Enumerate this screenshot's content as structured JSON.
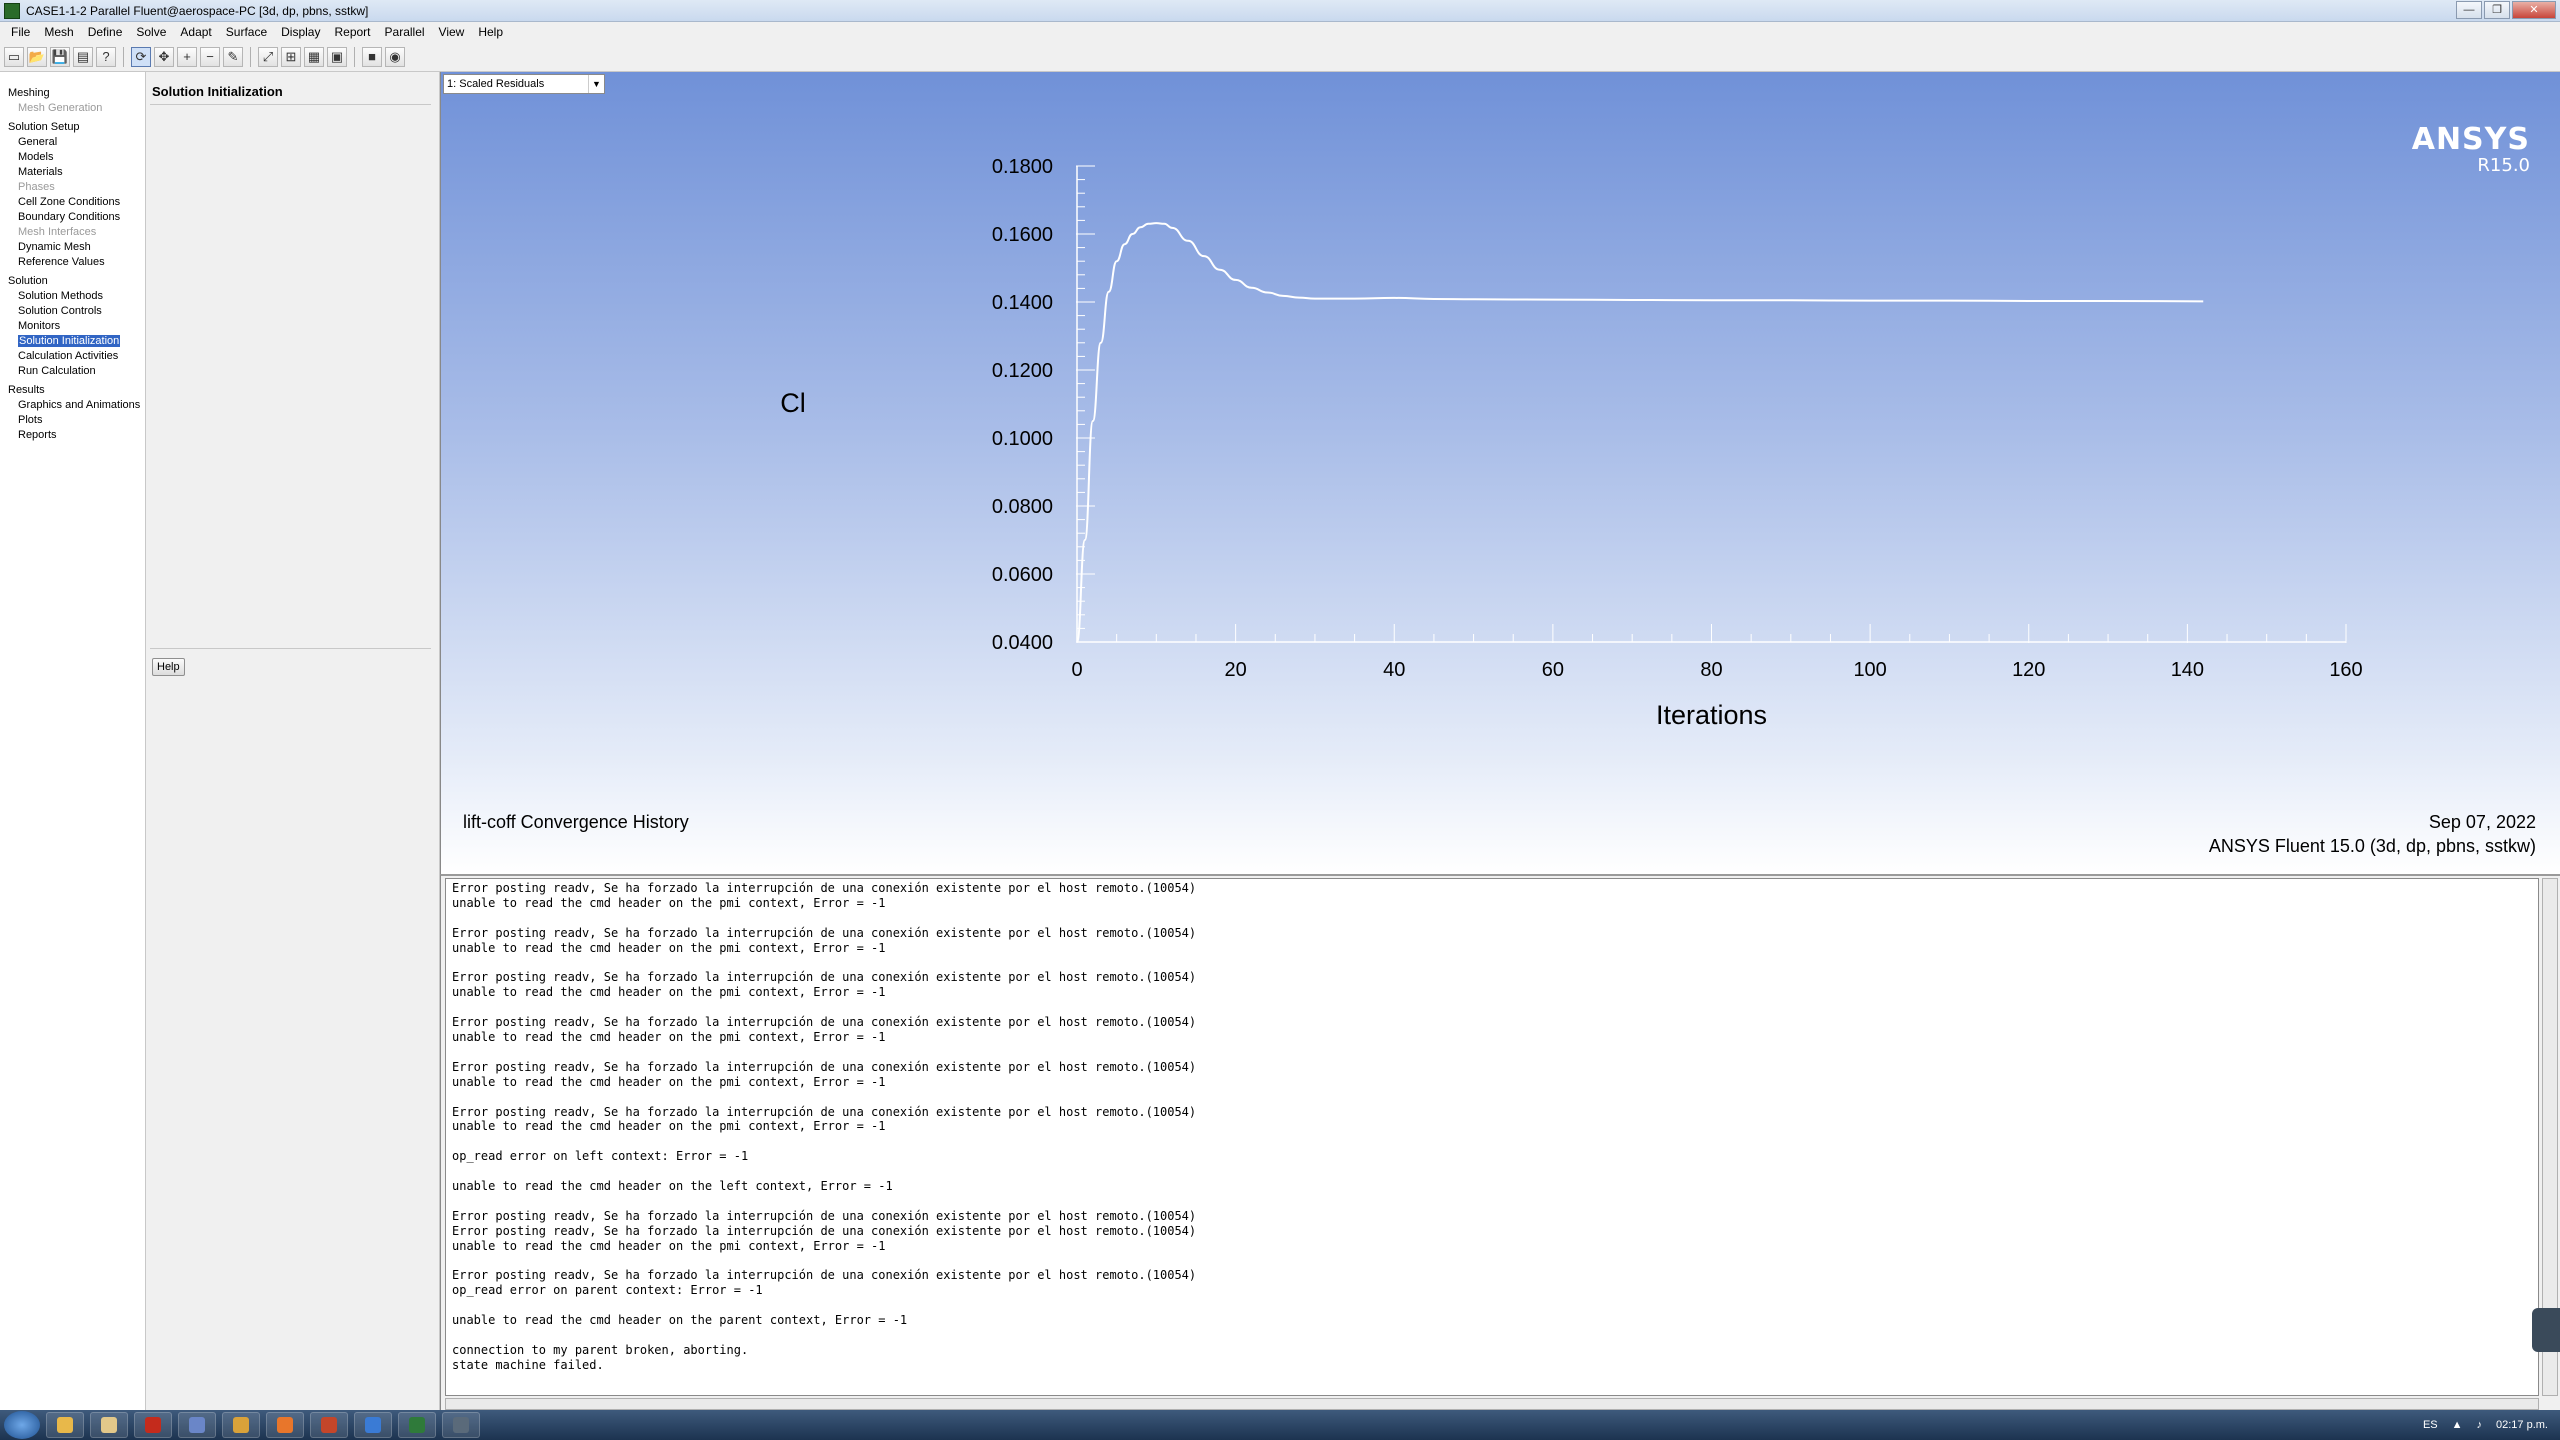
{
  "window": {
    "title": "CASE1-1-2 Parallel Fluent@aerospace-PC  [3d, dp, pbns, sstkw]"
  },
  "menu": [
    "File",
    "Mesh",
    "Define",
    "Solve",
    "Adapt",
    "Surface",
    "Display",
    "Report",
    "Parallel",
    "View",
    "Help"
  ],
  "toolbar_icons": [
    "new-icon",
    "open-icon",
    "save-icon",
    "print-icon",
    "help-icon",
    "rotate-icon",
    "pan-icon",
    "zoom-in-icon",
    "zoom-out-icon",
    "probe-icon",
    "fit-icon",
    "zoom-box-icon",
    "layout-icon",
    "view-icon",
    "display-icon",
    "camera-icon"
  ],
  "tree": {
    "meshing": {
      "label": "Meshing",
      "items": [
        {
          "label": "Mesh Generation",
          "disabled": true
        }
      ]
    },
    "solution_setup": {
      "label": "Solution Setup",
      "items": [
        {
          "label": "General"
        },
        {
          "label": "Models"
        },
        {
          "label": "Materials"
        },
        {
          "label": "Phases",
          "disabled": true
        },
        {
          "label": "Cell Zone Conditions"
        },
        {
          "label": "Boundary Conditions"
        },
        {
          "label": "Mesh Interfaces",
          "disabled": true
        },
        {
          "label": "Dynamic Mesh"
        },
        {
          "label": "Reference Values"
        }
      ]
    },
    "solution": {
      "label": "Solution",
      "items": [
        {
          "label": "Solution Methods"
        },
        {
          "label": "Solution Controls"
        },
        {
          "label": "Monitors"
        },
        {
          "label": "Solution Initialization",
          "selected": true
        },
        {
          "label": "Calculation Activities"
        },
        {
          "label": "Run Calculation"
        }
      ]
    },
    "results": {
      "label": "Results",
      "items": [
        {
          "label": "Graphics and Animations"
        },
        {
          "label": "Plots"
        },
        {
          "label": "Reports"
        }
      ]
    }
  },
  "task_page": {
    "title": "Solution Initialization",
    "help_label": "Help"
  },
  "graphics": {
    "window_selector": "1: Scaled Residuals",
    "logo_brand": "ANSYS",
    "logo_version": "R15.0",
    "plot_title": "lift-coff Convergence History",
    "date": "Sep 07, 2022",
    "solver_info": "ANSYS Fluent 15.0 (3d, dp, pbns, sstkw)",
    "line_color": "#ffffff"
  },
  "chart_data": {
    "type": "line",
    "title": "lift-coff Convergence History",
    "xlabel": "Iterations",
    "ylabel": "Cl",
    "xlim": [
      0,
      160
    ],
    "ylim": [
      0.04,
      0.18
    ],
    "x_ticks": [
      "0",
      "20",
      "40",
      "60",
      "80",
      "100",
      "120",
      "140",
      "160"
    ],
    "y_ticks": [
      "0.0400",
      "0.0600",
      "0.0800",
      "0.1000",
      "0.1200",
      "0.1400",
      "0.1600",
      "0.1800"
    ],
    "grid": false,
    "series": [
      {
        "x": [
          0,
          1,
          2,
          3,
          4,
          5,
          6,
          7,
          8,
          9,
          10,
          11,
          12,
          14,
          16,
          18,
          20,
          22,
          24,
          26,
          28,
          30,
          35,
          40,
          45,
          50,
          60,
          70,
          80,
          90,
          100,
          110,
          120,
          130,
          142
        ],
        "values": [
          0.04,
          0.07,
          0.105,
          0.128,
          0.143,
          0.152,
          0.157,
          0.16,
          0.162,
          0.163,
          0.1632,
          0.163,
          0.1618,
          0.158,
          0.1535,
          0.1495,
          0.1465,
          0.1442,
          0.1428,
          0.1418,
          0.1413,
          0.141,
          0.141,
          0.1412,
          0.1409,
          0.1408,
          0.1407,
          0.1406,
          0.1405,
          0.1405,
          0.1404,
          0.1404,
          0.1403,
          0.1403,
          0.1402
        ]
      }
    ]
  },
  "console": {
    "lines": [
      "Error posting readv, Se ha forzado la interrupción de una conexión existente por el host remoto.(10054)",
      "unable to read the cmd header on the pmi context, Error = -1",
      "",
      "Error posting readv, Se ha forzado la interrupción de una conexión existente por el host remoto.(10054)",
      "unable to read the cmd header on the pmi context, Error = -1",
      "",
      "Error posting readv, Se ha forzado la interrupción de una conexión existente por el host remoto.(10054)",
      "unable to read the cmd header on the pmi context, Error = -1",
      "",
      "Error posting readv, Se ha forzado la interrupción de una conexión existente por el host remoto.(10054)",
      "unable to read the cmd header on the pmi context, Error = -1",
      "",
      "Error posting readv, Se ha forzado la interrupción de una conexión existente por el host remoto.(10054)",
      "unable to read the cmd header on the pmi context, Error = -1",
      "",
      "Error posting readv, Se ha forzado la interrupción de una conexión existente por el host remoto.(10054)",
      "unable to read the cmd header on the pmi context, Error = -1",
      "",
      "op_read error on left context: Error = -1",
      "",
      "unable to read the cmd header on the left context, Error = -1",
      "",
      "Error posting readv, Se ha forzado la interrupción de una conexión existente por el host remoto.(10054)",
      "Error posting readv, Se ha forzado la interrupción de una conexión existente por el host remoto.(10054)",
      "unable to read the cmd header on the pmi context, Error = -1",
      "",
      "Error posting readv, Se ha forzado la interrupción de una conexión existente por el host remoto.(10054)",
      "op_read error on parent context: Error = -1",
      "",
      "unable to read the cmd header on the parent context, Error = -1",
      "",
      "connection to my parent broken, aborting.",
      "state machine failed."
    ]
  },
  "taskbar": {
    "apps": [
      "explorer-icon",
      "folder-icon",
      "acrobat-icon",
      "chrome-icon",
      "chrome-icon",
      "firefox-icon",
      "firefox-icon",
      "teamviewer-icon",
      "fluent-icon",
      "fluent-launcher-icon"
    ],
    "app_colors": [
      "#e8b84a",
      "#e2c88a",
      "#c42b1c",
      "#6a86c8",
      "#d9a23a",
      "#e8762b",
      "#c4462a",
      "#3a7bd5",
      "#2f7a3a",
      "#5a6a7a"
    ],
    "language": "ES",
    "clock": "02:17 p.m."
  }
}
